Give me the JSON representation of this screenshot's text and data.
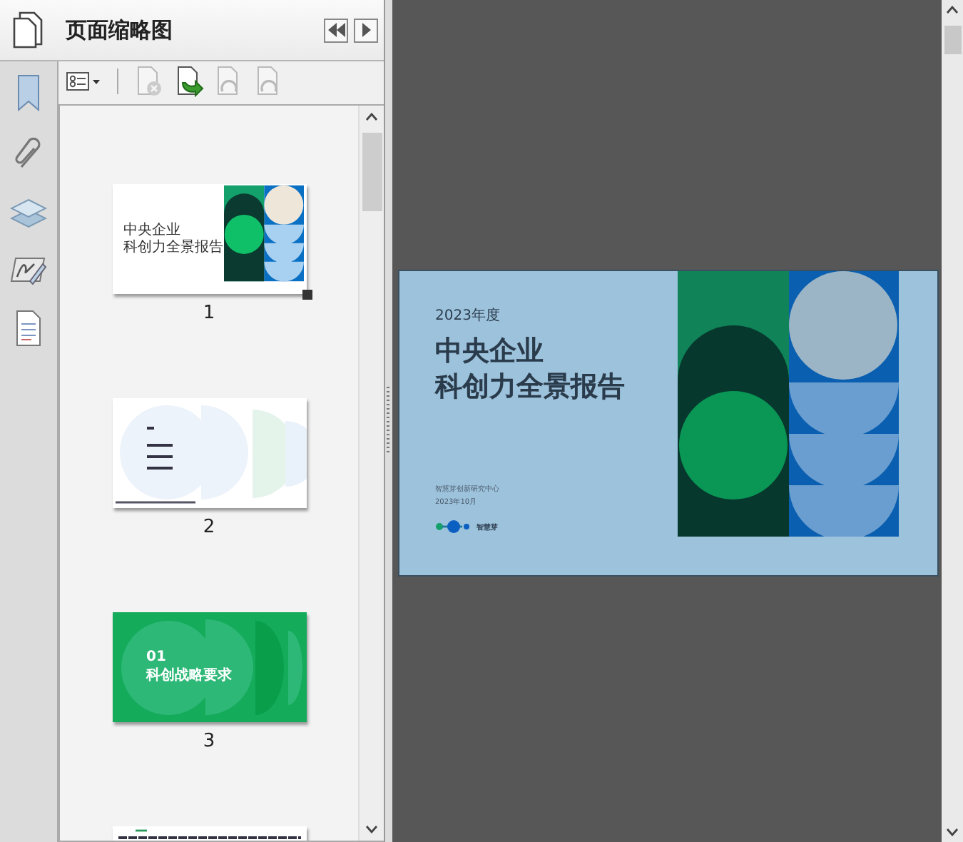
{
  "panel": {
    "title": "页面缩略图"
  },
  "toolbar": [
    {
      "kind": "options",
      "disabled": false
    },
    {
      "kind": "delete",
      "disabled": true
    },
    {
      "kind": "insert",
      "disabled": false
    },
    {
      "kind": "rotate",
      "disabled": true
    },
    {
      "kind": "rotate",
      "disabled": true
    }
  ],
  "thumbnails": [
    {
      "kind": "cover",
      "page_label": "1",
      "selected": true,
      "title_lines": [
        "中央企业",
        "科创力全景报告"
      ]
    },
    {
      "kind": "contents",
      "page_label": "2",
      "selected": false
    },
    {
      "kind": "section",
      "page_label": "3",
      "selected": false,
      "number": "01",
      "heading": "科创战略要求"
    },
    {
      "kind": "text",
      "selected": false
    }
  ],
  "page": {
    "year": "2023年度",
    "title_lines": [
      "中央企业",
      "科创力全景报告"
    ],
    "org": "智慧芽创新研究中心",
    "date": "2023年10月",
    "logo_text": "智慧芽"
  }
}
